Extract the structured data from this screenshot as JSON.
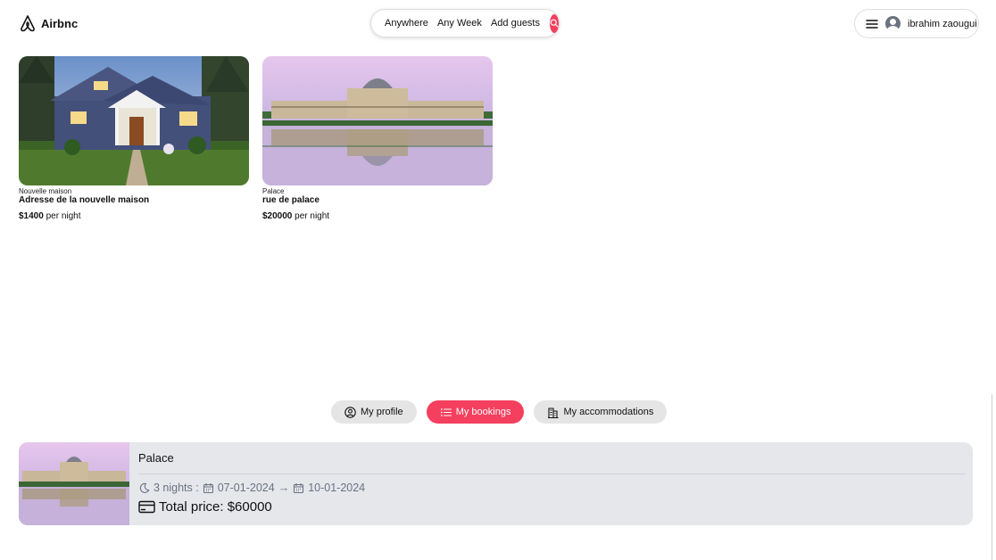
{
  "brand": {
    "name": "Airbnc",
    "accent": "#f43f5e"
  },
  "search": {
    "where": "Anywhere",
    "when": "Any Week",
    "guests": "Add guests",
    "icon": "search-icon"
  },
  "user": {
    "name": "ibrahim zaougui",
    "menu_icon": "hamburger-icon",
    "avatar_icon": "user-avatar-icon"
  },
  "listings": [
    {
      "type": "Nouvelle maison",
      "address": "Adresse de la nouvelle maison",
      "price": "$1400",
      "unit": "per night"
    },
    {
      "type": "Palace",
      "address": "rue de palace",
      "price": "$20000",
      "unit": "per night"
    }
  ],
  "tabs": [
    {
      "label": "My profile",
      "icon": "user-circle-icon",
      "active": false
    },
    {
      "label": "My bookings",
      "icon": "list-icon",
      "active": true
    },
    {
      "label": "My accommodations",
      "icon": "building-icon",
      "active": false
    }
  ],
  "booking": {
    "title": "Palace",
    "nights": "3 nights :",
    "check_in": "07-01-2024",
    "arrow": "→",
    "check_out": "10-01-2024",
    "total_label": "Total price: $60000"
  }
}
